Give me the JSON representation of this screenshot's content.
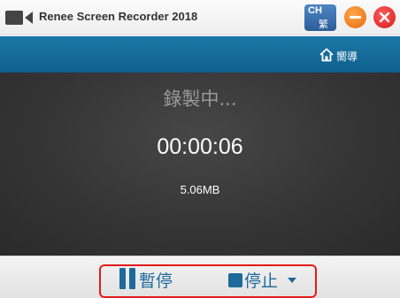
{
  "window": {
    "title": "Renee Screen Recorder 2018",
    "app_icon": "video-camera-icon",
    "language_code": "CH",
    "language_char": "繁",
    "minimize_icon": "minimize-icon",
    "close_icon": "close-icon"
  },
  "nav": {
    "home_icon": "home-icon",
    "home_label": "嚮導"
  },
  "recording": {
    "status": "錄製中...",
    "elapsed": "00:00:06",
    "file_size": "5.06MB"
  },
  "controls": {
    "pause_label": "暫停",
    "pause_icon": "pause-icon",
    "stop_label": "停止",
    "stop_icon": "stop-icon",
    "dropdown_icon": "caret-down-icon",
    "highlight_color": "#e31b1b"
  },
  "colors": {
    "accent": "#1e6a9a",
    "navbar": "#1470a0",
    "panel_bg": "#353535"
  }
}
